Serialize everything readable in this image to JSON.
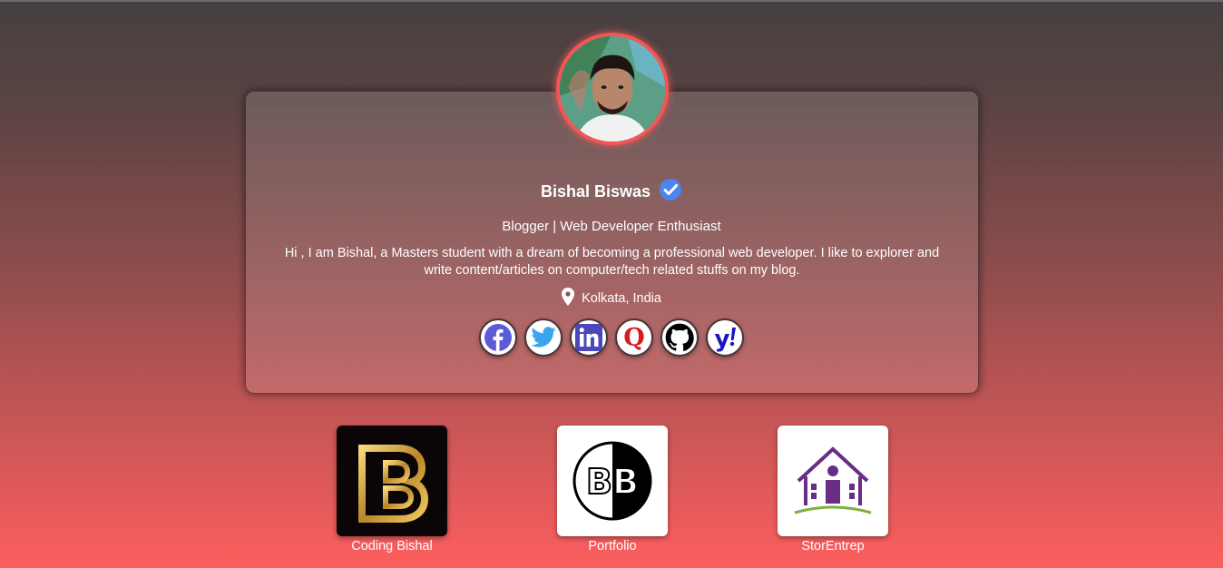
{
  "profile": {
    "name": "Bishal Biswas",
    "tagline": "Blogger | Web Developer Enthusiast",
    "bio": "Hi , I am Bishal, a Masters student with a dream of becoming a professional web developer. I like to explorer and write content/articles on computer/tech related stuffs on my blog.",
    "location": "Kolkata, India"
  },
  "socials": [
    {
      "icon": "facebook-icon",
      "color": "#5b5bd6"
    },
    {
      "icon": "twitter-icon",
      "color": "#3aa4ef"
    },
    {
      "icon": "linkedin-icon",
      "color": "#4b47b8"
    },
    {
      "icon": "quora-icon",
      "color": "#d91a1a"
    },
    {
      "icon": "github-icon",
      "color": "#000000"
    },
    {
      "icon": "yahoo-icon",
      "color": "#1a16c8"
    }
  ],
  "links": [
    {
      "label": "Coding Bishal"
    },
    {
      "label": "Portfolio"
    },
    {
      "label": "StorEntrep"
    }
  ],
  "colors": {
    "avatar_border": "#f45656",
    "verified_badge": "#4a86f0",
    "background_bottom": "#fc5e5e"
  }
}
